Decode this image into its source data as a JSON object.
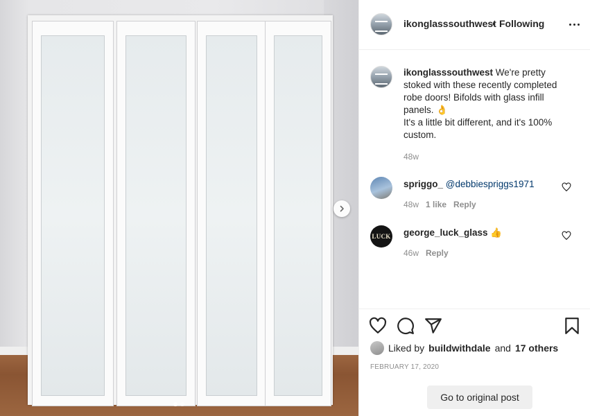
{
  "post": {
    "author": "ikonglasssouthwest",
    "follow_separator": "•",
    "follow_status": "Following",
    "caption_line1": "We're pretty stoked with these recently completed robe doors! Bifolds with glass infill panels. 👌",
    "caption_line2": "It's a little bit different, and it's 100% custom.",
    "caption_time": "48w"
  },
  "carousel": {
    "slide_count": 2,
    "active_index": 0
  },
  "comments": [
    {
      "username": "spriggo_",
      "mention": "@debbiespriggs1971",
      "time": "48w",
      "likes": "1 like",
      "reply": "Reply"
    },
    {
      "username": "george_luck_glass",
      "text": "👍",
      "time": "46w",
      "reply": "Reply",
      "avatar_text": "LUCK"
    }
  ],
  "likes": {
    "prefix": "Liked by",
    "user": "buildwithdale",
    "conjunction": "and",
    "others": "17 others"
  },
  "date": "FEBRUARY 17, 2020",
  "goto_label": "Go to original post",
  "icons": [
    "chevron-right-icon",
    "more-icon",
    "heart-icon",
    "comment-icon",
    "share-icon",
    "bookmark-icon"
  ],
  "colors": {
    "mention": "#00376b",
    "muted": "#8e8e8e",
    "text": "#262626"
  }
}
